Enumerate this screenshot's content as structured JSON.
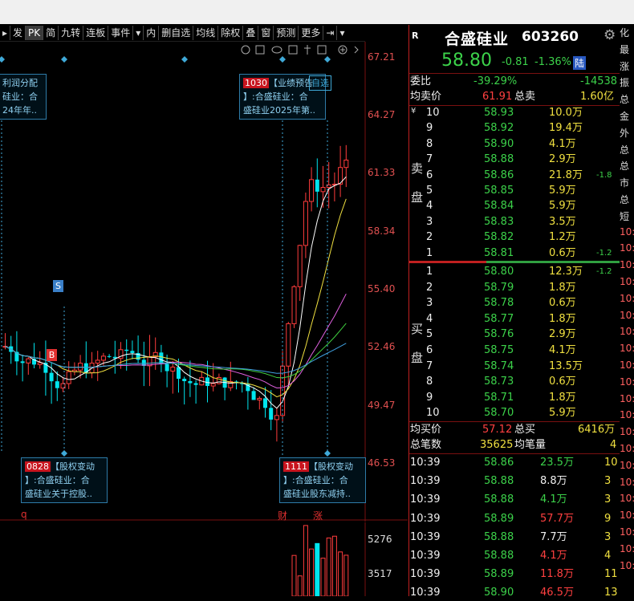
{
  "toolbar": {
    "items": [
      "发",
      "PK",
      "简",
      "九转",
      "连板",
      "事件",
      "内",
      "删自选",
      "均线",
      "除权",
      "叠",
      "窗",
      "预测",
      "更多"
    ]
  },
  "price_axis": [
    "67.21",
    "64.27",
    "61.33",
    "58.34",
    "55.40",
    "52.46",
    "49.47",
    "46.53"
  ],
  "volume_axis": [
    "5276",
    "3517"
  ],
  "notes": {
    "left_top": {
      "line1": "利润分配",
      "line2": "硅业：合",
      "line3": "24年年.."
    },
    "mid_top": {
      "tag": "1030",
      "line1": "【业绩预告",
      "line1b": "自选",
      "line2": "】:合盛硅业：合",
      "line3": "盛硅业2025年第.."
    },
    "left_bottom": {
      "tag": "0828",
      "line1": "【股权变动",
      "line2": "】:合盛硅业：合",
      "line3": "盛硅业关于控股.."
    },
    "right_bottom": {
      "tag": "1111",
      "line1": "【股权变动",
      "line2": "】:合盛硅业：合",
      "line3": "盛硅业股东减持.."
    }
  },
  "markers": {
    "sell": "S",
    "buy": "B",
    "bottom_labels": [
      "q",
      "财",
      "涨"
    ]
  },
  "quote": {
    "r_label": "R",
    "name": "合盛硅业",
    "code": "603260",
    "price": "58.80",
    "change": "-0.81",
    "change_pct": "-1.36%",
    "exchange_badge": "陆",
    "weibi_label": "委比",
    "weibi_value": "-39.29%",
    "weicha_value": "-14538",
    "junmai_label": "均卖价",
    "junmai_value": "61.91",
    "zongmai_label": "总卖",
    "zongmai_value": "1.60亿",
    "sell_side_label_1": "卖",
    "sell_side_label_2": "盘",
    "buy_side_label_1": "买",
    "buy_side_label_2": "盘",
    "sells": [
      {
        "level": "10",
        "price": "58.93",
        "vol": "10.0万",
        "extra": ""
      },
      {
        "level": "9",
        "price": "58.92",
        "vol": "19.4万",
        "extra": ""
      },
      {
        "level": "8",
        "price": "58.90",
        "vol": "4.1万",
        "extra": ""
      },
      {
        "level": "7",
        "price": "58.88",
        "vol": "2.9万",
        "extra": ""
      },
      {
        "level": "6",
        "price": "58.86",
        "vol": "21.8万",
        "extra": "-1.8"
      },
      {
        "level": "5",
        "price": "58.85",
        "vol": "5.9万",
        "extra": ""
      },
      {
        "level": "4",
        "price": "58.84",
        "vol": "5.9万",
        "extra": ""
      },
      {
        "level": "3",
        "price": "58.83",
        "vol": "3.5万",
        "extra": ""
      },
      {
        "level": "2",
        "price": "58.82",
        "vol": "1.2万",
        "extra": ""
      },
      {
        "level": "1",
        "price": "58.81",
        "vol": "0.6万",
        "extra": "-1.2"
      }
    ],
    "buys": [
      {
        "level": "1",
        "price": "58.80",
        "vol": "12.3万",
        "extra": "-1.2"
      },
      {
        "level": "2",
        "price": "58.79",
        "vol": "1.8万",
        "extra": ""
      },
      {
        "level": "3",
        "price": "58.78",
        "vol": "0.6万",
        "extra": ""
      },
      {
        "level": "4",
        "price": "58.77",
        "vol": "1.8万",
        "extra": ""
      },
      {
        "level": "5",
        "price": "58.76",
        "vol": "2.9万",
        "extra": ""
      },
      {
        "level": "6",
        "price": "58.75",
        "vol": "4.1万",
        "extra": ""
      },
      {
        "level": "7",
        "price": "58.74",
        "vol": "13.5万",
        "extra": ""
      },
      {
        "level": "8",
        "price": "58.73",
        "vol": "0.6万",
        "extra": ""
      },
      {
        "level": "9",
        "price": "58.71",
        "vol": "1.8万",
        "extra": ""
      },
      {
        "level": "10",
        "price": "58.70",
        "vol": "5.9万",
        "extra": ""
      }
    ],
    "junmai2_label": "均买价",
    "junmai2_value": "57.12",
    "zongmai2_label": "总买",
    "zongmai2_value": "6416万",
    "zongbishu_label": "总笔数",
    "zongbishu_value": "35625",
    "junbiliang_label": "均笔量",
    "junbiliang_value": "4",
    "ticks": [
      {
        "time": "10:39",
        "price": "58.86",
        "vol": "23.5万",
        "n": "10",
        "vcolor": "green"
      },
      {
        "time": "10:39",
        "price": "58.88",
        "vol": "8.8万",
        "n": "3",
        "vcolor": "white"
      },
      {
        "time": "10:39",
        "price": "58.88",
        "vol": "4.1万",
        "n": "3",
        "vcolor": "green"
      },
      {
        "time": "10:39",
        "price": "58.89",
        "vol": "57.7万",
        "n": "9",
        "vcolor": "red"
      },
      {
        "time": "10:39",
        "price": "58.88",
        "vol": "7.7万",
        "n": "3",
        "vcolor": "white"
      },
      {
        "time": "10:39",
        "price": "58.88",
        "vol": "4.1万",
        "n": "4",
        "vcolor": "red"
      },
      {
        "time": "10:39",
        "price": "58.89",
        "vol": "11.8万",
        "n": "11",
        "vcolor": "red"
      },
      {
        "time": "10:39",
        "price": "58.90",
        "vol": "46.5万",
        "n": "13",
        "vcolor": "red"
      }
    ]
  },
  "right_strip": [
    "化",
    "最",
    "涨",
    "振",
    "总",
    "金",
    "外",
    "总",
    "总",
    "市",
    "总",
    "短",
    "10:",
    "10:",
    "10:",
    "10:",
    "10:",
    "10:",
    "10:",
    "10:",
    "10:",
    "10:",
    "10:",
    "10:",
    "10:",
    "10:",
    "10:",
    "10:",
    "10:",
    "10:",
    "10:",
    "10:",
    "10:"
  ],
  "colors": {
    "up": "#ff3c3c",
    "down": "#00e5ee",
    "green": "#3cd24a",
    "ma1": "#ffffff",
    "ma2": "#f0e040",
    "ma3": "#e060e0",
    "ma4": "#40d040",
    "ma5": "#40a0e0"
  }
}
